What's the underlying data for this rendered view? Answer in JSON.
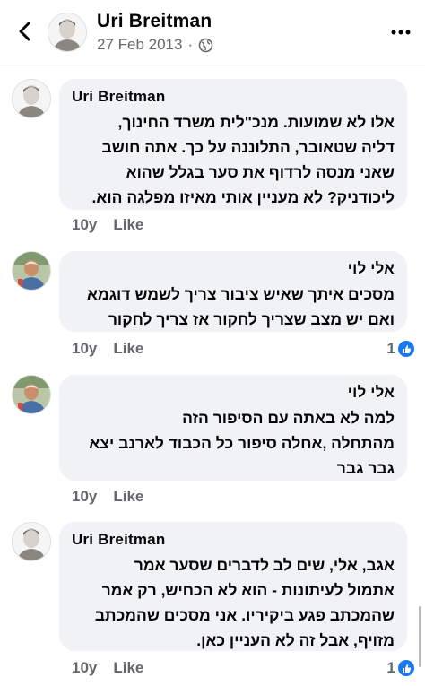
{
  "header": {
    "name": "Uri Breitman",
    "date": "27 Feb 2013",
    "separator": "·",
    "back_icon": "chevron-left-icon",
    "privacy_icon": "globe-icon",
    "more_icon": "more-vertical-icon"
  },
  "comments": [
    {
      "author": "Uri Breitman",
      "lines": [
        "אלו לא שמועות. מנכ\"לית משרד החינוך,",
        "דליה שטאובר, התלוננה על כך. אתה חושב",
        "שאני מנסה לרדוף את סער בגלל שהוא",
        "ליכודניק? לא מעניין אותי מאיזו מפלגה הוא."
      ],
      "age": "10y",
      "like_label": "Like",
      "reactions": ""
    },
    {
      "author": "אלי לוי",
      "lines": [
        "מסכים איתך שאיש ציבור צריך לשמש דוגמא",
        "ואם יש מצב שצריך לחקור אז צריך לחקור"
      ],
      "age": "10y",
      "like_label": "Like",
      "reactions": "1"
    },
    {
      "author": "אלי לוי",
      "lines": [
        "למה לא באתה עם הסיפור הזה",
        "מהתחלה ,אחלה סיפור כל הכבוד לארנב יצא",
        "גבר גבר"
      ],
      "age": "10y",
      "like_label": "Like",
      "reactions": ""
    },
    {
      "author": "Uri Breitman",
      "lines": [
        "אגב, אלי, שים לב לדברים שסער אמר",
        "אתמול לעיתונות - הוא לא הכחיש, רק אמר",
        "שהמכתב פגע ביקיריו. אני מסכים שהמכתב",
        "מזויף, אבל זה לא העניין כאן."
      ],
      "age": "10y",
      "like_label": "Like",
      "reactions": "1"
    }
  ],
  "colors": {
    "bubble": "#f0f2f5",
    "meta": "#65676b",
    "like_blue": "#1877f2"
  }
}
